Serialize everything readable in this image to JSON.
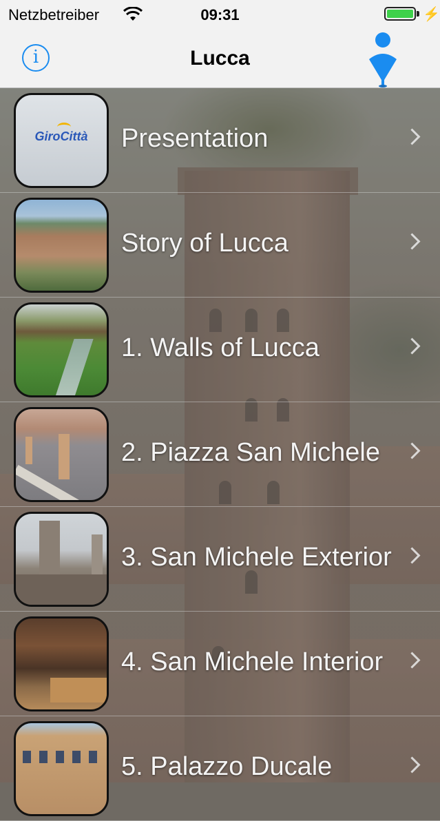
{
  "status_bar": {
    "carrier": "Netzbetreiber",
    "time": "09:31",
    "battery_level": 1.0,
    "battery_color": "#3ed14a"
  },
  "nav": {
    "title": "Lucca",
    "info_icon": "info-icon",
    "info_glyph": "i",
    "location_icon": "person-pin-icon",
    "accent": "#1a8cf0"
  },
  "list": {
    "items": [
      {
        "label": "Presentation",
        "thumb_text": "GiroCittà",
        "thumb": "logo"
      },
      {
        "label": "Story of Lucca",
        "thumb": "city-panorama"
      },
      {
        "label": "1. Walls of Lucca",
        "thumb": "canal-walls"
      },
      {
        "label": "2. Piazza San Michele",
        "thumb": "piazza-bollards"
      },
      {
        "label": "3. San Michele Exterior",
        "thumb": "church-facade"
      },
      {
        "label": "4. San Michele Interior",
        "thumb": "church-interior"
      },
      {
        "label": "5. Palazzo Ducale",
        "thumb": "palazzo"
      }
    ]
  }
}
